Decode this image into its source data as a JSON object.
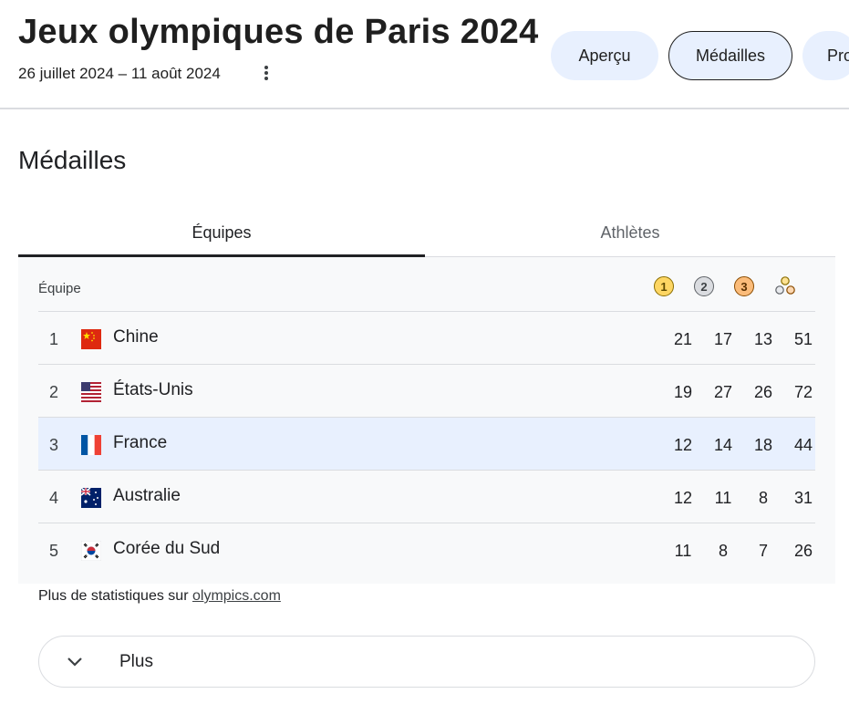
{
  "header": {
    "title": "Jeux olympiques de Paris 2024",
    "dates": "26 juillet 2024 – 11 août 2024",
    "chips": [
      "Aperçu",
      "Médailles",
      "Pro"
    ]
  },
  "section": {
    "title": "Médailles"
  },
  "tabs": {
    "teams": "Équipes",
    "athletes": "Athlètes"
  },
  "table": {
    "team_header": "Équipe",
    "medal_icons": [
      "gold-medal-icon",
      "silver-medal-icon",
      "bronze-medal-icon",
      "total-medals-icon"
    ],
    "medal_numbers": [
      "1",
      "2",
      "3"
    ],
    "rows": [
      {
        "rank": "1",
        "country": "Chine",
        "flag": "china-flag-icon",
        "gold": "21",
        "silver": "17",
        "bronze": "13",
        "total": "51"
      },
      {
        "rank": "2",
        "country": "États-Unis",
        "flag": "usa-flag-icon",
        "gold": "19",
        "silver": "27",
        "bronze": "26",
        "total": "72"
      },
      {
        "rank": "3",
        "country": "France",
        "flag": "france-flag-icon",
        "gold": "12",
        "silver": "14",
        "bronze": "18",
        "total": "44"
      },
      {
        "rank": "4",
        "country": "Australie",
        "flag": "australia-flag-icon",
        "gold": "12",
        "silver": "11",
        "bronze": "8",
        "total": "31"
      },
      {
        "rank": "5",
        "country": "Corée du Sud",
        "flag": "south-korea-flag-icon",
        "gold": "11",
        "silver": "8",
        "bronze": "7",
        "total": "26"
      }
    ]
  },
  "footer": {
    "stats_prefix": "Plus de statistiques sur",
    "stats_link": "olympics.com"
  },
  "more": {
    "label": "Plus"
  },
  "colors": {
    "gold": "#fdd663",
    "silver": "#dadce0",
    "bronze": "#fbbc7a",
    "highlight": "#e8f0fe",
    "chip_bg": "#e8f0fe"
  }
}
